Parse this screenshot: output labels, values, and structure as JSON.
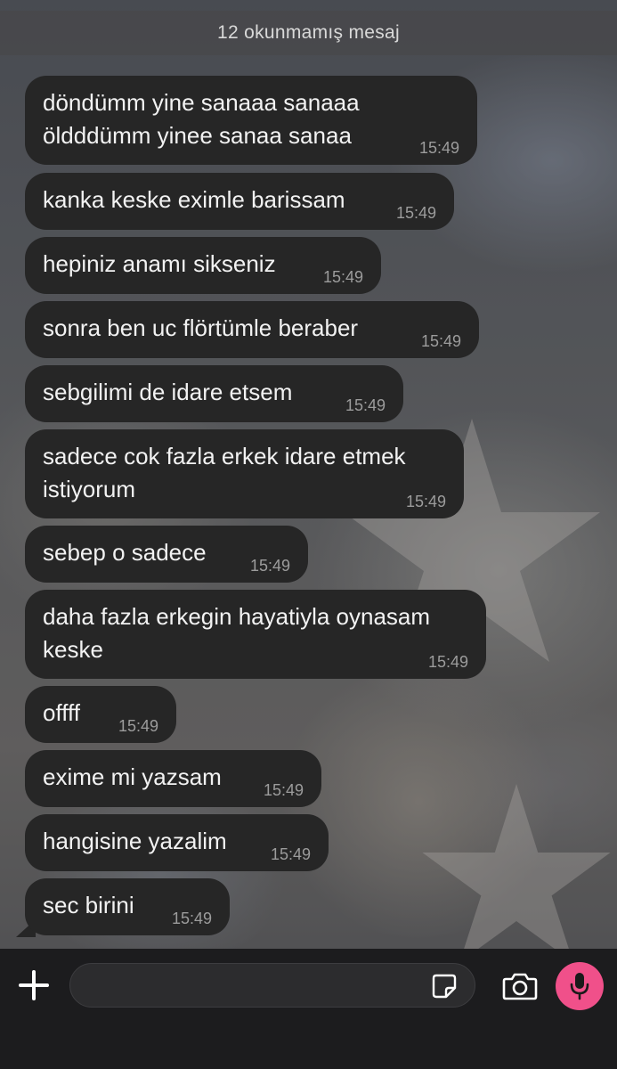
{
  "unread_banner": "12 okunmamış mesaj",
  "messages": [
    {
      "text": "döndümm yine sanaaa sanaaa\nöldddümm yinee sanaa sanaa",
      "time": "15:49"
    },
    {
      "text": "kanka keske eximle barissam",
      "time": "15:49"
    },
    {
      "text": "hepiniz anamı sikseniz",
      "time": "15:49"
    },
    {
      "text": "sonra ben uc flörtümle beraber",
      "time": "15:49"
    },
    {
      "text": "sebgilimi de idare etsem",
      "time": "15:49"
    },
    {
      "text": "sadece cok fazla erkek idare etmek\nistiyorum",
      "time": "15:49"
    },
    {
      "text": "sebep o sadece",
      "time": "15:49"
    },
    {
      "text": "daha fazla erkegin hayatiyla oynasam\nkeske",
      "time": "15:49"
    },
    {
      "text": "offff",
      "time": "15:49"
    },
    {
      "text": "exime mi yazsam",
      "time": "15:49"
    },
    {
      "text": "hangisine yazalim",
      "time": "15:49"
    },
    {
      "text": "sec birini",
      "time": "15:49"
    }
  ],
  "composer": {
    "input_value": "",
    "input_placeholder": "",
    "icons": [
      "plus-icon",
      "sticker-icon",
      "camera-icon",
      "microphone-icon"
    ]
  },
  "colors": {
    "bubble": "#262626",
    "bubble_text": "#f2f2f2",
    "timestamp": "#9c9c9c",
    "mic_button": "#f0508a",
    "composer_bg": "#1c1c1e"
  }
}
